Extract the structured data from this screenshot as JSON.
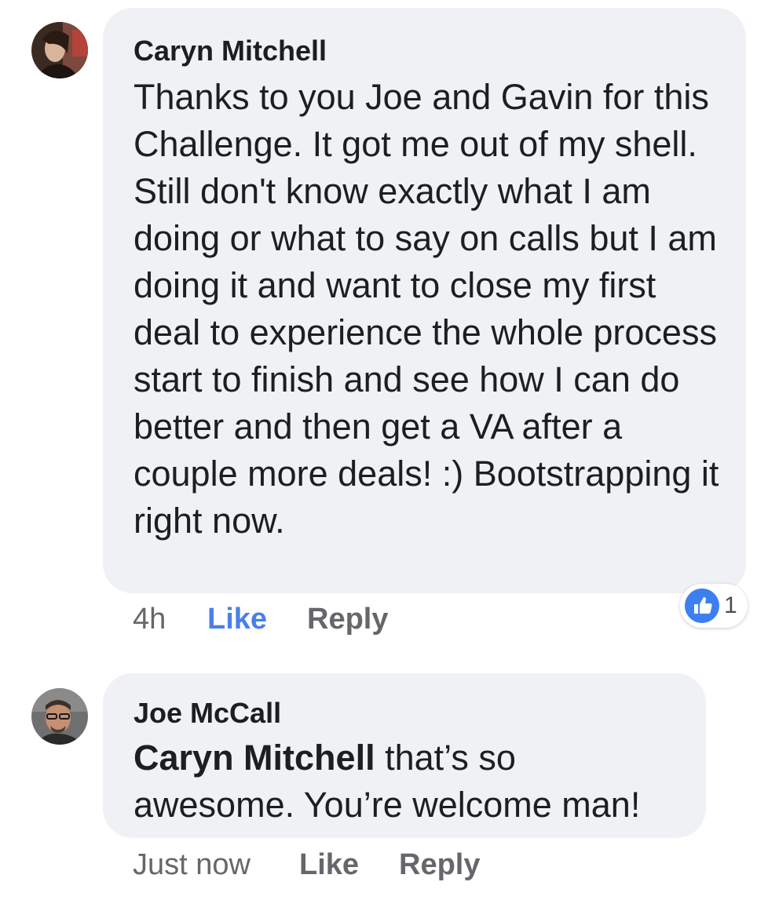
{
  "comments": [
    {
      "author": "Caryn Mitchell",
      "text": "Thanks to you Joe and Gavin for this Challenge. It got me out of my shell. Still don't know exactly what I am doing or what to say on calls but I am doing it and want to close my first deal to experience the whole process start to finish and see how I can do better and then get a VA after a couple more deals! :) Bootstrapping it right now.",
      "time": "4h",
      "like_label": "Like",
      "reply_label": "Reply",
      "reaction_count": "1",
      "reaction_icon": "thumbs-up-icon",
      "like_color": "#4a80e8"
    },
    {
      "author": "Joe McCall",
      "mention": "Caryn Mitchell",
      "text": " that’s so awesome. You’re welcome man!",
      "time": "Just now",
      "like_label": "Like",
      "reply_label": "Reply"
    }
  ],
  "colors": {
    "bubble": "#f0f1f4",
    "meta": "#65676b",
    "reaction": "#3d7ff0"
  }
}
